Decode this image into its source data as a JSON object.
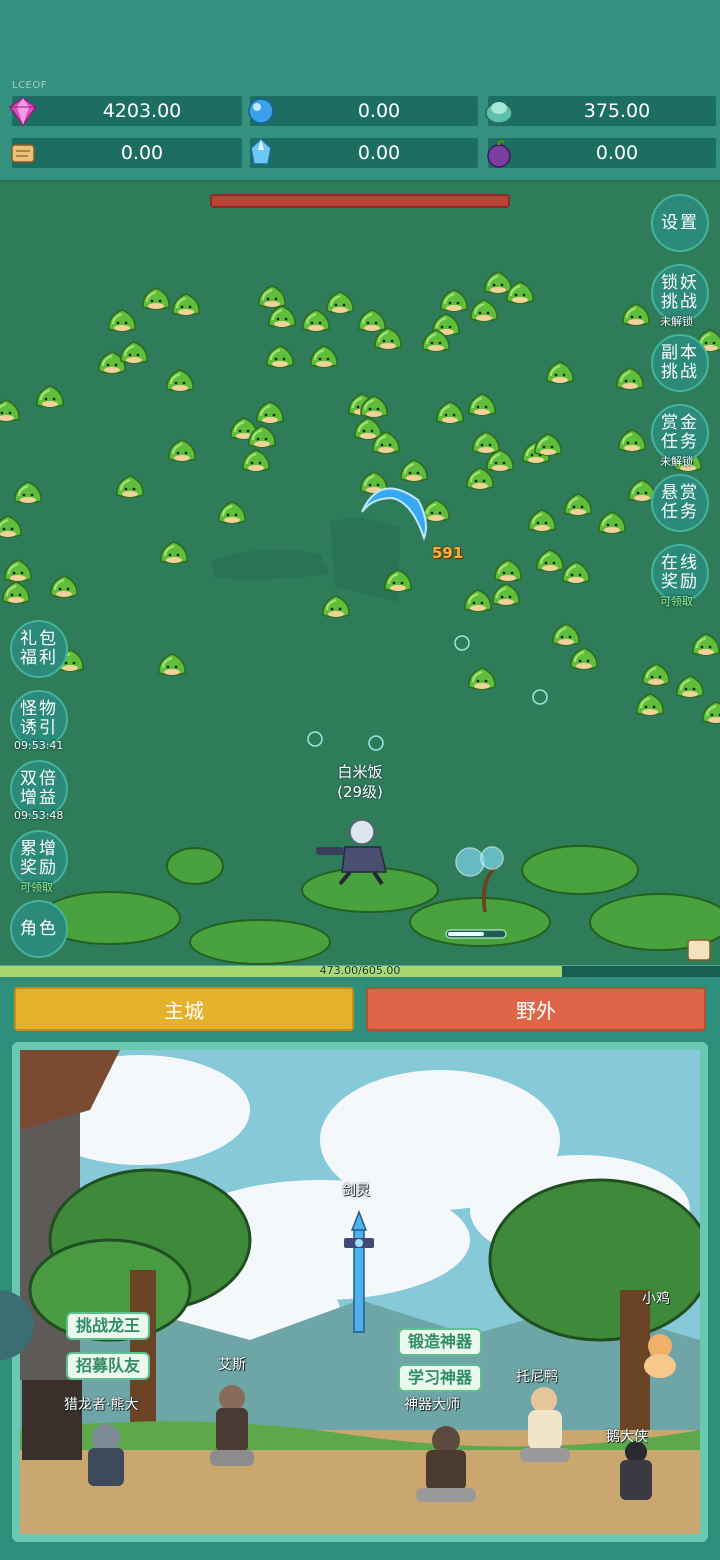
{
  "top": {
    "tag": "LCEOF",
    "resources": [
      {
        "id": "diamond",
        "value": "4203.00",
        "icon": "pink-diamond-icon",
        "color": "#e04cc4"
      },
      {
        "id": "crystal",
        "value": "0.00",
        "icon": "blue-crystal-icon",
        "color": "#3aa0e8"
      },
      {
        "id": "orb",
        "value": "375.00",
        "icon": "teal-orb-icon",
        "color": "#5cc0a8"
      },
      {
        "id": "scroll",
        "value": "0.00",
        "icon": "scroll-icon",
        "color": "#e8c27a"
      },
      {
        "id": "ice",
        "value": "0.00",
        "icon": "ice-crystal-icon",
        "color": "#6cc8f4"
      },
      {
        "id": "fruit",
        "value": "0.00",
        "icon": "purple-fruit-icon",
        "color": "#7a3ea0"
      }
    ]
  },
  "right_menu": {
    "settings": "设置",
    "lock_demon": "锁妖挑战",
    "lock_demon_status": "未解锁",
    "dungeon": "副本挑战",
    "bounty": "赏金任务",
    "bounty_status": "未解锁",
    "reward_task": "悬赏任务",
    "online": "在线奖励",
    "online_status": "可领取"
  },
  "left_menu": {
    "gift": "礼包福利",
    "lure": "怪物诱引",
    "lure_timer": "09:53:41",
    "double": "双倍增益",
    "double_timer": "09:53:48",
    "accum": "累增奖励",
    "accum_status": "可领取",
    "role": "角色"
  },
  "player": {
    "name": "白米饭",
    "level": "(29级)"
  },
  "damage": "591",
  "xp": {
    "text": "473.00/605.00",
    "fraction": 0.781
  },
  "tabs": {
    "city": "主城",
    "wild": "野外"
  },
  "scene": {
    "sword": "剑灵",
    "btn_dragon": "挑战龙王",
    "btn_recruit": "招募队友",
    "btn_forge": "锻造神器",
    "btn_learn": "学习神器",
    "npc_hunter": "猎龙者·熊大",
    "npc_aisi": "艾斯",
    "npc_master": "神器大师",
    "npc_tony": "托尼鸭",
    "npc_chick": "小鸡",
    "npc_goose": "鹅大侠"
  }
}
